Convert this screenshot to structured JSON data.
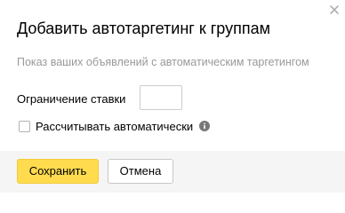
{
  "dialog": {
    "title": "Добавить автотаргетинг к группам",
    "subtitle": "Показ ваших объявлений с автоматическим таргетингом",
    "close_icon": "close-icon"
  },
  "bid_limit": {
    "label": "Ограничение ставки",
    "value": ""
  },
  "auto_calc": {
    "label": "Рассчитывать автоматически",
    "checked": false,
    "info_icon": "info-icon"
  },
  "footer": {
    "save_label": "Сохранить",
    "cancel_label": "Отмена"
  },
  "colors": {
    "primary_button": "#ffdb4d",
    "footer_bg": "#f5f5f5",
    "subtitle_text": "#999999"
  }
}
